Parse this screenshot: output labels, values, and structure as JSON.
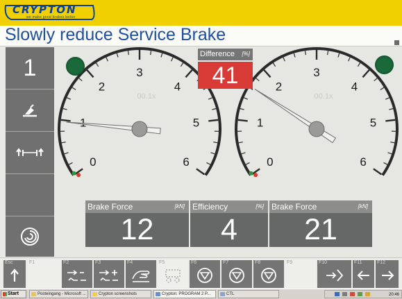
{
  "header": {
    "logo_text": "CRYPTON",
    "logo_tagline": "we make good brakes better",
    "page_title": "Slowly reduce Service Brake"
  },
  "sidebar": {
    "items": [
      {
        "label": "1",
        "icon": "step-number"
      },
      {
        "label": "",
        "icon": "brake-pedal-icon"
      },
      {
        "label": "",
        "icon": "axle-icon"
      },
      {
        "label": "",
        "icon": ""
      },
      {
        "label": "",
        "icon": "spiral-icon"
      }
    ]
  },
  "gauges": {
    "scale_ticks": [
      "0",
      "1",
      "2",
      "3",
      "4",
      "5",
      "6"
    ],
    "left": {
      "value": 0.97,
      "watermark": "00.1x"
    },
    "right": {
      "value": 1.63,
      "watermark": "00.1x"
    },
    "indicator_color": "#19693a"
  },
  "difference": {
    "label": "Difference",
    "unit": "[%]",
    "value": "41",
    "color": "#d83a35"
  },
  "panels": [
    {
      "label": "Brake Force",
      "unit": "[kN]",
      "value": "12"
    },
    {
      "label": "Efficiency",
      "unit": "[%]",
      "value": "4"
    },
    {
      "label": "Brake Force",
      "unit": "[kN]",
      "value": "21"
    }
  ],
  "function_keys": [
    {
      "label": "Esc",
      "icon": "arrow-up-icon",
      "style": "dark"
    },
    {
      "label": "F1",
      "icon": "",
      "style": "light"
    },
    {
      "label": "F2",
      "icon": "arrows-minus-icon",
      "style": "dark"
    },
    {
      "label": "F3",
      "icon": "arrows-plus-icon",
      "style": "dark"
    },
    {
      "label": "F4",
      "icon": "hand-icon",
      "style": "dark"
    },
    {
      "label": "F5",
      "icon": "dashed-vehicle-icon",
      "style": "light"
    },
    {
      "label": "F6",
      "icon": "triangle-down-icon",
      "style": "dark"
    },
    {
      "label": "F7",
      "icon": "triangle-down-icon",
      "style": "dark"
    },
    {
      "label": "F8",
      "icon": "triangle-down-icon",
      "style": "dark"
    },
    {
      "label": "F9",
      "icon": "",
      "style": "light"
    },
    {
      "label": "F10",
      "icon": "arrow-enter-icon",
      "style": "dark"
    },
    {
      "label": "F11",
      "icon": "arrow-left-icon",
      "style": "dark"
    },
    {
      "label": "F12",
      "icon": "arrow-right-icon",
      "style": "dark"
    }
  ],
  "taskbar": {
    "start_label": "Start",
    "tasks": [
      "Posteingang - Microsoft ...",
      "Crypton screenshots",
      "Crypton: PROGRAM 2 P...",
      "CTL"
    ],
    "clock": "20:46"
  }
}
